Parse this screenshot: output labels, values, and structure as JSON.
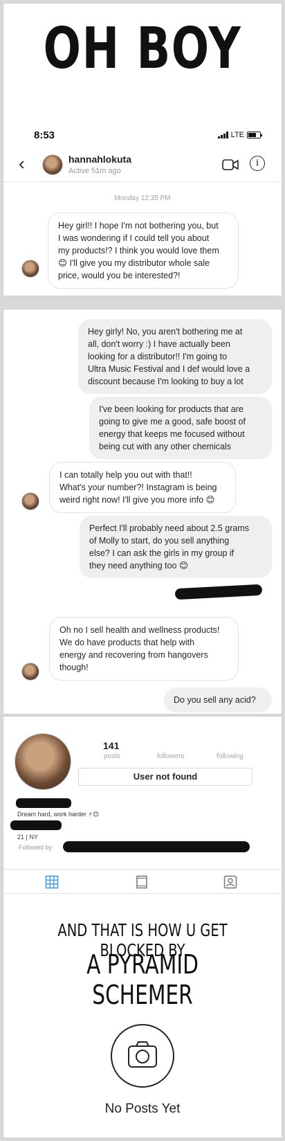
{
  "panel1": {
    "meme_title": "OH BOY",
    "status_time": "8:53",
    "network": "LTE",
    "username": "hannahlokuta",
    "active_status": "Active 51m ago",
    "timestamp": "Monday 12:35 PM",
    "first_message": [
      "Hey girl!! I hope I'm not bothering you, but",
      "I was wondering if I could tell you about",
      "my products!? I think you would love them",
      "😊 I'll give you my distributor whole sale",
      "price, would you be interested?!"
    ]
  },
  "panel2": {
    "messages": [
      {
        "from": "me",
        "lines": [
          "Hey girly! No, you aren't bothering me at",
          "all, don't worry :) I have actually been",
          "looking for a distributor!! I'm going to",
          "Ultra Music Festival and I def would love a",
          "discount because I'm looking to buy a lot"
        ]
      },
      {
        "from": "me",
        "lines": [
          "I've been looking for products that are",
          "going to give me a good, safe boost of",
          "energy that keeps me focused without",
          "being cut with any other chemicals"
        ]
      },
      {
        "from": "them",
        "lines": [
          "I can totally help you out with that!!",
          "What's your number?! Instagram is being",
          "weird right now! I'll give you more info 😊"
        ]
      },
      {
        "from": "me",
        "lines": [
          "Perfect I'll probably need about 2.5 grams",
          "of Molly to start, do you sell anything",
          "else? I can ask the girls in my group if",
          "they need anything too 😊"
        ]
      },
      {
        "from": "them",
        "lines": [
          "Oh no I sell health and wellness products!",
          "We do have products that help with",
          "energy and recovering from hangovers",
          "though!"
        ]
      },
      {
        "from": "me",
        "lines": [
          "Do you sell any acid?"
        ]
      }
    ]
  },
  "panel3": {
    "posts_count": "141",
    "posts_label": "posts",
    "followers_label": "followers",
    "following_label": "following",
    "user_not_found": "User not found",
    "bio": "Dream hard, work harder ⚡😊",
    "location": "21 | NY",
    "followed_by": "Followed by",
    "caption_line1": "AND THAT IS HOW U GET BLOCKED BY",
    "caption_line2": "A PYRAMID SCHEMER",
    "no_posts": "No Posts Yet"
  }
}
